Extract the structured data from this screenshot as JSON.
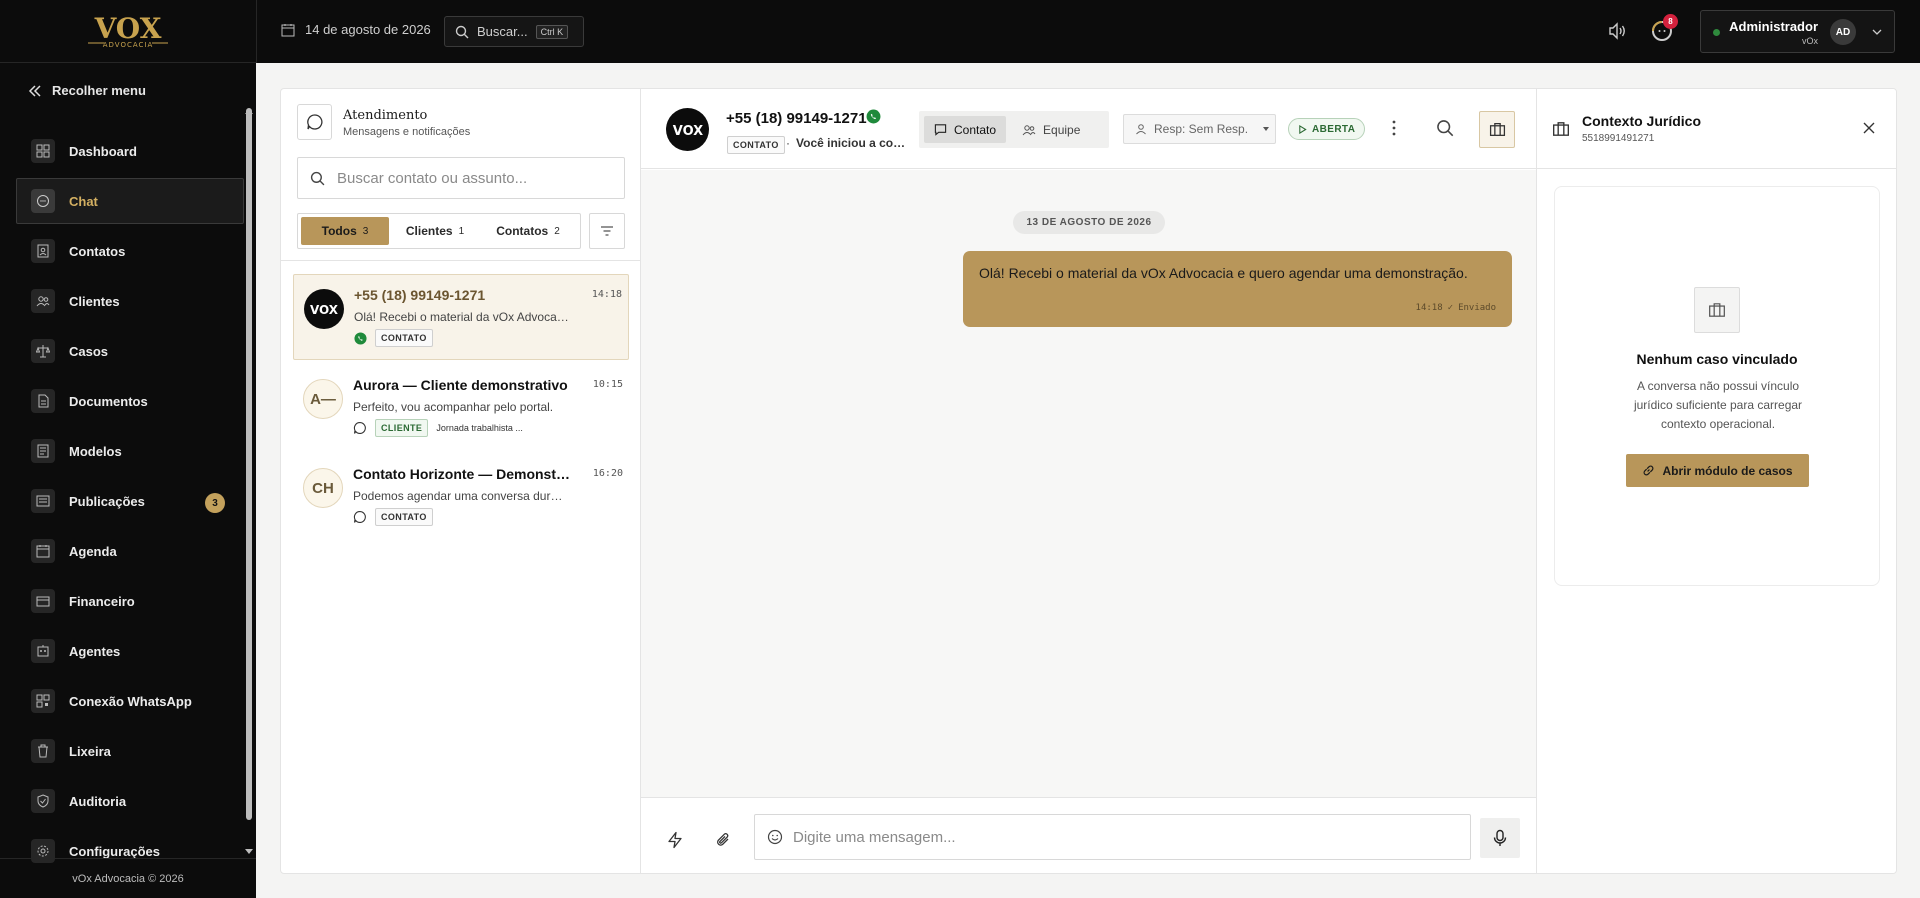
{
  "colors": {
    "accent": "#b8965a",
    "sidebar_bg": "#0c0c0c",
    "active_label": "#d4b062",
    "badge_red": "#d4213d",
    "open_green": "#2c6a34"
  },
  "brand": {
    "logo_text": "VOX",
    "logo_sub": "ADVOCACIA"
  },
  "sidebar": {
    "collapse_label": "Recolher menu",
    "items": [
      {
        "label": "Dashboard",
        "icon": "dashboard-icon"
      },
      {
        "label": "Chat",
        "icon": "chat-icon",
        "active": true
      },
      {
        "label": "Contatos",
        "icon": "contacts-icon"
      },
      {
        "label": "Clientes",
        "icon": "clients-icon"
      },
      {
        "label": "Casos",
        "icon": "scales-icon"
      },
      {
        "label": "Documentos",
        "icon": "documents-icon"
      },
      {
        "label": "Modelos",
        "icon": "templates-icon"
      },
      {
        "label": "Publicações",
        "icon": "publications-icon",
        "badge": "3"
      },
      {
        "label": "Agenda",
        "icon": "calendar-icon"
      },
      {
        "label": "Financeiro",
        "icon": "wallet-icon"
      },
      {
        "label": "Agentes",
        "icon": "agents-icon"
      },
      {
        "label": "Conexão WhatsApp",
        "icon": "whatsapp-connection-icon"
      },
      {
        "label": "Lixeira",
        "icon": "trash-icon"
      },
      {
        "label": "Auditoria",
        "icon": "shield-icon"
      },
      {
        "label": "Configurações",
        "icon": "gear-icon"
      }
    ],
    "footer": "vOx Advocacia © 2026"
  },
  "topbar": {
    "date": "14 de agosto de 2026",
    "search_label": "Buscar...",
    "search_shortcut": "Ctrl K",
    "notifications_count": "8",
    "user": {
      "name": "Administrador",
      "org": "vOx",
      "initials": "AD"
    }
  },
  "conversations_panel": {
    "title": "Atendimento",
    "subtitle": "Mensagens e notificações",
    "search_placeholder": "Buscar contato ou assunto...",
    "filters": [
      {
        "label": "Todos",
        "count": "3",
        "active": true
      },
      {
        "label": "Clientes",
        "count": "1"
      },
      {
        "label": "Contatos",
        "count": "2"
      }
    ],
    "conversations": [
      {
        "name": "+55 (18) 99149-1271",
        "time": "14:18",
        "preview": "Olá! Recebi o material da vOx Advocacia e quero agendar uma demonstração.",
        "tag": "CONTATO",
        "channel": "whatsapp",
        "avatar": "vox",
        "active": true
      },
      {
        "name": "Aurora — Cliente demonstrativo",
        "time": "10:15",
        "preview": "Perfeito, vou acompanhar pelo portal.",
        "tag": "CLIENTE",
        "sub": "Jornada trabalhista ...",
        "channel": "chat",
        "initials": "A—"
      },
      {
        "name": "Contato Horizonte — Demonstração",
        "time": "16:20",
        "preview": "Podemos agendar uma conversa durante a semana?",
        "tag": "CONTATO",
        "channel": "chat",
        "initials": "CH"
      }
    ]
  },
  "chat": {
    "phone": "+55 (18) 99149-1271",
    "tag": "CONTATO",
    "status_line": "Você iniciou a conversa",
    "tabs": [
      {
        "label": "Contato",
        "active": true
      },
      {
        "label": "Equipe"
      }
    ],
    "responsible": "Resp: Sem Resp.",
    "status": "ABERTA",
    "date_divider": "13 DE AGOSTO DE 2026",
    "messages": [
      {
        "text": "Olá! Recebi o material da vOx Advocacia e quero agendar uma demonstração.",
        "time": "14:18",
        "status": "Enviado"
      }
    ],
    "input_placeholder": "Digite uma mensagem..."
  },
  "context_panel": {
    "title": "Contexto Jurídico",
    "id": "5518991491271",
    "empty_title": "Nenhum caso vinculado",
    "empty_desc": "A conversa não possui vínculo jurídico suficiente para carregar contexto operacional.",
    "button": "Abrir módulo de casos"
  }
}
